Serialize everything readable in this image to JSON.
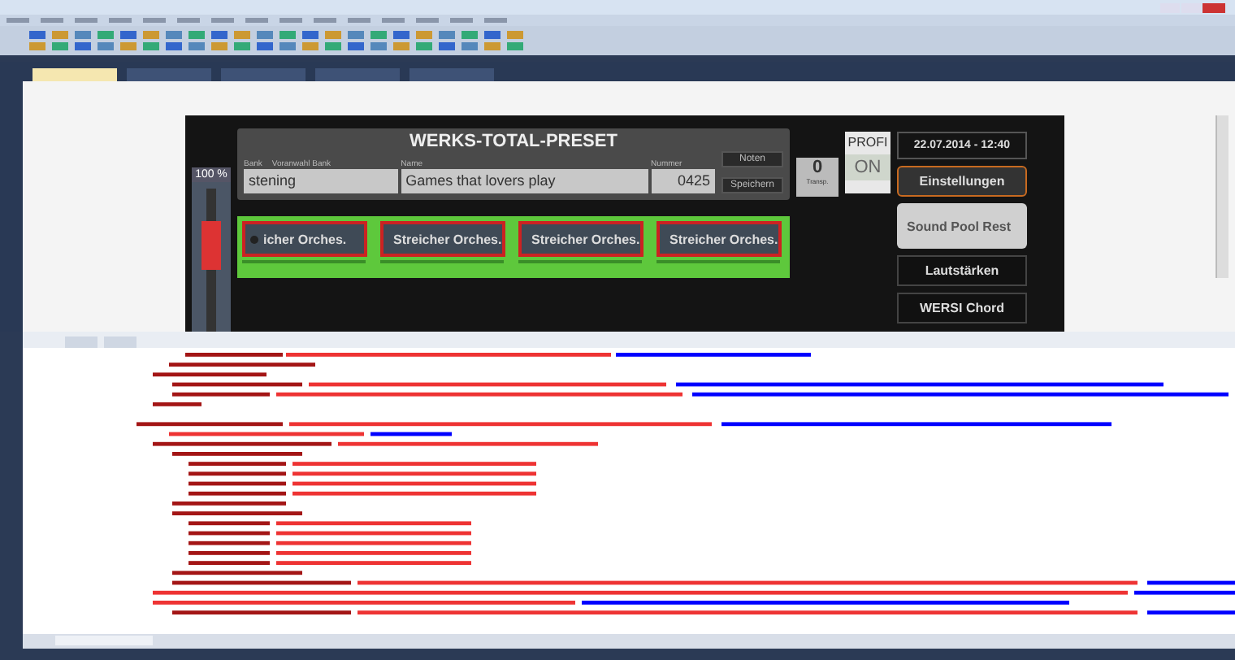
{
  "preset": {
    "title": "WERKS-TOTAL-PRESET",
    "bank_label": "Bank",
    "preselect_label": "Voranwahl Bank",
    "bank_value": "stening",
    "name_label": "Name",
    "name_value": "Games that lovers play",
    "number_label": "Nummer",
    "number_value": "0425",
    "buttons": [
      "Noten",
      "Speichern"
    ]
  },
  "transpose": {
    "value": "0",
    "label": "Transp."
  },
  "profi": {
    "label": "PROFI",
    "state": "ON"
  },
  "datetime": "22.07.2014 - 12:40",
  "side_buttons": [
    {
      "label": "Einstellungen",
      "kind": "outlined"
    },
    {
      "label": "Sound Pool Rest",
      "kind": "light"
    },
    {
      "label": "Lautstärken",
      "kind": "dark"
    },
    {
      "label": "WERSI Chord",
      "kind": "dark"
    }
  ],
  "sound_slots": [
    {
      "label": "icher Orches."
    },
    {
      "label": "Streicher Orches."
    },
    {
      "label": "Streicher Orches."
    },
    {
      "label": "Streicher Orches."
    }
  ],
  "volume_slider": {
    "reading": "100 %",
    "level": 0.7
  },
  "document_tabs": [
    {
      "selected": true
    },
    {
      "selected": false
    },
    {
      "selected": false
    },
    {
      "selected": false
    },
    {
      "selected": false
    }
  ]
}
